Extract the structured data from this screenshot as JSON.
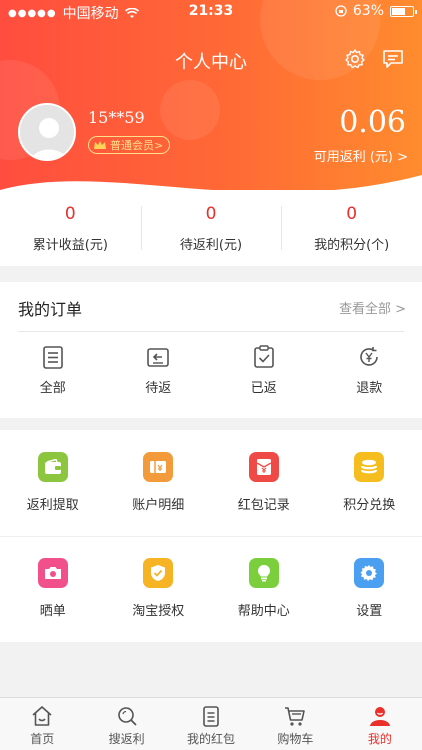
{
  "status_bar": {
    "carrier": "中国移动",
    "time": "21:33",
    "battery": "63%"
  },
  "header": {
    "title": "个人中心"
  },
  "user": {
    "name": "15**59",
    "member_level": "普通会员>",
    "balance": "0.06",
    "balance_label": "可用返利 (元) >"
  },
  "stats": [
    {
      "value": "0",
      "label": "累计收益(元)"
    },
    {
      "value": "0",
      "label": "待返利(元)"
    },
    {
      "value": "0",
      "label": "我的积分(个)"
    }
  ],
  "orders": {
    "title": "我的订单",
    "view_all": "查看全部 >",
    "items": [
      {
        "label": "全部",
        "icon": "list-icon"
      },
      {
        "label": "待返",
        "icon": "return-pending-icon"
      },
      {
        "label": "已返",
        "icon": "returned-check-icon"
      },
      {
        "label": "退款",
        "icon": "refund-yen-icon"
      }
    ]
  },
  "services": [
    {
      "label": "返利提取",
      "icon": "wallet-icon",
      "color": "#8cc63f"
    },
    {
      "label": "账户明细",
      "icon": "ledger-icon",
      "color": "#f39a3b"
    },
    {
      "label": "红包记录",
      "icon": "red-envelope-icon",
      "color": "#ef4a45"
    },
    {
      "label": "积分兑换",
      "icon": "coins-icon",
      "color": "#f6bd1e"
    },
    {
      "label": "晒单",
      "icon": "camera-icon",
      "color": "#f2508a"
    },
    {
      "label": "淘宝授权",
      "icon": "shield-check-icon",
      "color": "#f6b324"
    },
    {
      "label": "帮助中心",
      "icon": "bulb-icon",
      "color": "#7ccf3c"
    },
    {
      "label": "设置",
      "icon": "gear-icon",
      "color": "#4a9ff0"
    }
  ],
  "tabbar": [
    {
      "label": "首页",
      "icon": "home-icon"
    },
    {
      "label": "搜返利",
      "icon": "search-icon"
    },
    {
      "label": "我的红包",
      "icon": "coupon-icon"
    },
    {
      "label": "购物车",
      "icon": "cart-icon"
    },
    {
      "label": "我的",
      "icon": "profile-icon",
      "active": true
    }
  ],
  "colors": {
    "accent": "#e9302b",
    "header_gradient_start": "#ff4d3f",
    "header_gradient_end": "#ff8c2e"
  }
}
